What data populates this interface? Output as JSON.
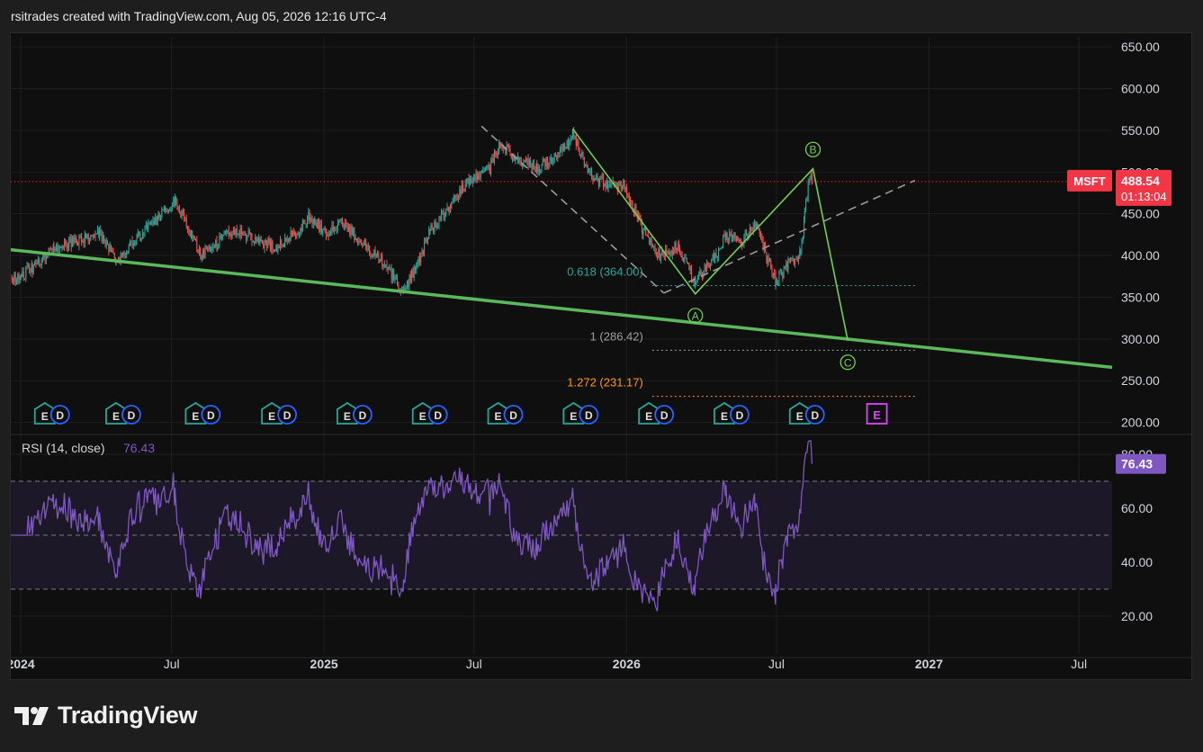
{
  "header": {
    "caption": "rsitrades created with TradingView.com, Aug 05, 2026 12:16 UTC-4"
  },
  "footer": {
    "brand": "TradingView"
  },
  "colors": {
    "background": "#0f0f0f",
    "grid": "#1f1f1f",
    "candle_up": "#26a69a",
    "candle_down": "#ef5350",
    "trendline": "#5cb85c",
    "wave": "#6fcf4f",
    "rsi_line": "#7e57c2",
    "rsi_band": "#1c1828",
    "price_badge": "#f23645",
    "rsi_badge": "#7e57c2",
    "fib_teal": "#26a69a",
    "fib_gray": "#9e9e9e",
    "fib_orange": "#ff9800",
    "earnings_teal": "#26a69a",
    "dividend_blue": "#2962ff",
    "earnings_future": "#e040fb"
  },
  "chart_data": [
    {
      "type": "candlestick",
      "symbol": "MSFT",
      "last_price": "488.54",
      "countdown": "01:13:04",
      "x_ticks": [
        "2024",
        "Jul",
        "2025",
        "Jul",
        "2026",
        "Jul",
        "2027",
        "Jul"
      ],
      "x_tick_dates": [
        "2024-01-01",
        "2024-07-01",
        "2025-01-01",
        "2025-07-01",
        "2026-01-01",
        "2026-07-01",
        "2027-01-01",
        "2027-07-01"
      ],
      "y_ticks": [
        "650.00",
        "600.00",
        "550.00",
        "500.00",
        "450.00",
        "400.00",
        "350.00",
        "300.00",
        "250.00",
        "200.00"
      ],
      "y_tick_values": [
        650,
        600,
        550,
        500,
        450,
        400,
        350,
        300,
        250,
        200
      ],
      "ylim": [
        192,
        662
      ],
      "xlim": [
        "2023-12-20",
        "2027-08-10"
      ],
      "price_path": [
        [
          "2023-12-20",
          370
        ],
        [
          "2024-01-15",
          385
        ],
        [
          "2024-02-10",
          410
        ],
        [
          "2024-03-10",
          418
        ],
        [
          "2024-04-05",
          425
        ],
        [
          "2024-04-25",
          395
        ],
        [
          "2024-05-20",
          420
        ],
        [
          "2024-06-15",
          445
        ],
        [
          "2024-07-05",
          466
        ],
        [
          "2024-08-05",
          400
        ],
        [
          "2024-08-25",
          415
        ],
        [
          "2024-09-15",
          432
        ],
        [
          "2024-10-10",
          418
        ],
        [
          "2024-11-05",
          410
        ],
        [
          "2024-11-25",
          425
        ],
        [
          "2024-12-15",
          447
        ],
        [
          "2025-01-05",
          425
        ],
        [
          "2025-01-25",
          442
        ],
        [
          "2025-02-15",
          412
        ],
        [
          "2025-03-15",
          392
        ],
        [
          "2025-04-07",
          354
        ],
        [
          "2025-04-25",
          395
        ],
        [
          "2025-05-10",
          430
        ],
        [
          "2025-06-01",
          460
        ],
        [
          "2025-06-25",
          490
        ],
        [
          "2025-07-20",
          505
        ],
        [
          "2025-08-01",
          535
        ],
        [
          "2025-08-20",
          515
        ],
        [
          "2025-09-15",
          505
        ],
        [
          "2025-10-10",
          520
        ],
        [
          "2025-10-28",
          545
        ],
        [
          "2025-11-20",
          495
        ],
        [
          "2025-12-10",
          485
        ],
        [
          "2025-12-31",
          483
        ],
        [
          "2026-01-20",
          430
        ],
        [
          "2026-02-10",
          400
        ],
        [
          "2026-03-05",
          410
        ],
        [
          "2026-03-25",
          368
        ],
        [
          "2026-04-15",
          395
        ],
        [
          "2026-05-01",
          425
        ],
        [
          "2026-05-20",
          418
        ],
        [
          "2026-06-05",
          440
        ],
        [
          "2026-06-20",
          398
        ],
        [
          "2026-06-30",
          368
        ],
        [
          "2026-07-15",
          388
        ],
        [
          "2026-07-30",
          402
        ],
        [
          "2026-08-04",
          450
        ],
        [
          "2026-08-10",
          498
        ],
        [
          "2026-08-14",
          488
        ]
      ],
      "rsi": {
        "label": "RSI (14, close)",
        "value": "76.43",
        "y_ticks": [
          "80.00",
          "60.00",
          "40.00",
          "20.00"
        ],
        "y_tick_values": [
          80,
          60,
          40,
          20
        ],
        "ylim": [
          6,
          86
        ],
        "band": [
          30,
          70
        ],
        "midline": 50
      },
      "fib_levels": [
        {
          "label": "0.618 (364.00)",
          "ratio": "0.618",
          "price": 364.0,
          "color_key": "fib_teal"
        },
        {
          "label": "1 (286.42)",
          "ratio": "1",
          "price": 286.42,
          "color_key": "fib_gray"
        },
        {
          "label": "1.272 (231.17)",
          "ratio": "1.272",
          "price": 231.17,
          "color_key": "fib_orange"
        }
      ],
      "wave_labels": [
        "A",
        "B",
        "C"
      ],
      "wave_path": [
        [
          "2025-10-28",
          552
        ],
        [
          "2026-03-25",
          354
        ],
        [
          "2026-08-14",
          504
        ],
        [
          "2026-09-25",
          298
        ]
      ],
      "wave_label_points": [
        {
          "label": "A",
          "date": "2026-03-25",
          "price": 328
        },
        {
          "label": "B",
          "date": "2026-08-14",
          "price": 527
        },
        {
          "label": "C",
          "date": "2026-09-25",
          "price": 272
        }
      ],
      "trendline": [
        [
          "2023-12-20",
          407
        ],
        [
          "2027-08-10",
          266
        ]
      ],
      "channel_line_1": [
        [
          "2025-07-10",
          555
        ],
        [
          "2026-02-15",
          355
        ]
      ],
      "channel_line_2": [
        [
          "2026-02-15",
          355
        ],
        [
          "2026-12-15",
          490
        ]
      ],
      "earnings_events": [
        "2024-01-30",
        "2024-04-25",
        "2024-07-30",
        "2024-10-30",
        "2025-01-29",
        "2025-04-30",
        "2025-07-30",
        "2025-10-29",
        "2026-01-28",
        "2026-04-29",
        "2026-07-29"
      ],
      "future_earnings_event": "2026-10-28",
      "earnings_icon_label": "E",
      "dividend_icon_label": "D"
    }
  ]
}
